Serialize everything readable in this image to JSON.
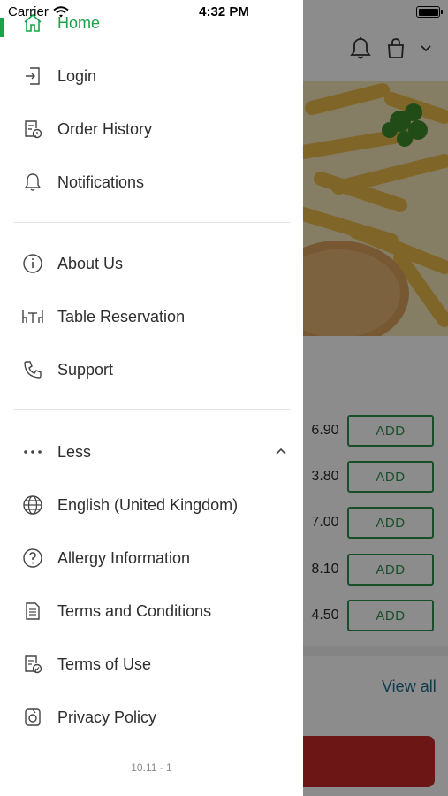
{
  "status_bar": {
    "carrier": "Carrier",
    "time": "4:32 PM"
  },
  "drawer": {
    "items": [
      {
        "label": "Home",
        "icon": "home-icon",
        "active": true
      },
      {
        "label": "Login",
        "icon": "login-icon"
      },
      {
        "label": "Order History",
        "icon": "order-history-icon"
      },
      {
        "label": "Notifications",
        "icon": "bell-icon"
      },
      {
        "label": "About Us",
        "icon": "info-icon"
      },
      {
        "label": "Table Reservation",
        "icon": "table-icon"
      },
      {
        "label": "Support",
        "icon": "phone-icon"
      },
      {
        "label": "Less",
        "icon": "more-dots-icon"
      },
      {
        "label": "English (United Kingdom)",
        "icon": "globe-icon"
      },
      {
        "label": "Allergy Information",
        "icon": "question-icon"
      },
      {
        "label": "Terms and Conditions",
        "icon": "document-icon"
      },
      {
        "label": "Terms of Use",
        "icon": "document-check-icon"
      },
      {
        "label": "Privacy Policy",
        "icon": "privacy-icon"
      }
    ],
    "version": "10.11 - 1"
  },
  "background": {
    "prices": [
      "6.90",
      "3.80",
      "7.00",
      "8.10",
      "4.50"
    ],
    "add_label": "ADD",
    "view_all": "View all"
  },
  "colors": {
    "accent": "#19a34a",
    "add_border": "#2f8f4e",
    "cta": "#c62828",
    "link": "#1b6e8a"
  }
}
